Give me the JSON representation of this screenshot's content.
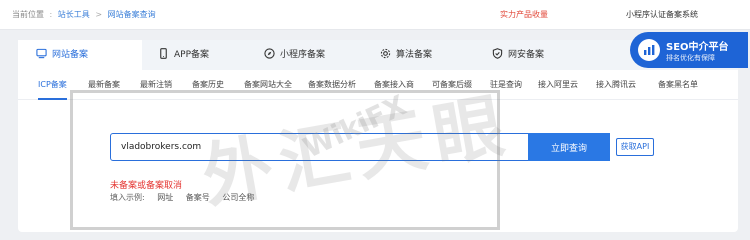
{
  "breadcrumb": {
    "prefix": "当前位置",
    "items": [
      "站长工具",
      "网站备案查询"
    ],
    "separator": ">"
  },
  "top_links": {
    "promo": "实力产品收量",
    "mini_program": "小程序认证备案系统"
  },
  "tabs": [
    {
      "label": "网站备案",
      "icon": "monitor-icon",
      "active": true
    },
    {
      "label": "APP备案",
      "icon": "phone-icon",
      "active": false
    },
    {
      "label": "小程序备案",
      "icon": "compass-icon",
      "active": false
    },
    {
      "label": "算法备案",
      "icon": "gear-icon",
      "active": false
    },
    {
      "label": "网安备案",
      "icon": "shield-icon",
      "active": false
    }
  ],
  "seo_badge": {
    "title": "SEO中介平台",
    "subtitle": "排名优化有保障"
  },
  "subnav": [
    {
      "label": "ICP备案",
      "active": true
    },
    {
      "label": "最新备案",
      "active": false
    },
    {
      "label": "最新注销",
      "active": false
    },
    {
      "label": "备案历史",
      "active": false
    },
    {
      "label": "备案网站大全",
      "active": false
    },
    {
      "label": "备案数据分析",
      "active": false
    },
    {
      "label": "备案接入商",
      "active": false
    },
    {
      "label": "可备案后缀",
      "active": false
    },
    {
      "label": "驻是查询",
      "active": false
    },
    {
      "label": "接入阿里云",
      "active": false
    },
    {
      "label": "接入腾讯云",
      "active": false
    },
    {
      "label": "备案黑名单",
      "active": false
    }
  ],
  "search": {
    "value": "vladobrokers.com",
    "button_label": "立即查询",
    "api_label": "获取API"
  },
  "result": {
    "status": "未备案或备案取消"
  },
  "examples": {
    "prefix": "填入示例:",
    "items": [
      "网址",
      "备案号",
      "公司全称"
    ]
  },
  "watermark": {
    "stamp_text": "外汇天眼",
    "brand": "WikiFX"
  },
  "colors": {
    "accent": "#2a6fdb",
    "error": "#e53935",
    "promo": "#e24a3b",
    "seo_bg": "#1e64d6"
  }
}
